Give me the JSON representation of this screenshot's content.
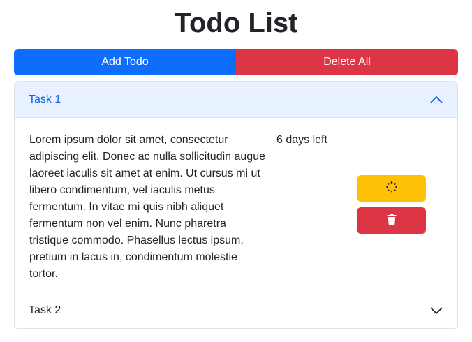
{
  "page": {
    "title": "Todo List"
  },
  "toolbar": {
    "add_label": "Add Todo",
    "delete_all_label": "Delete All"
  },
  "colors": {
    "primary": "#0d6efd",
    "danger": "#dc3545",
    "warning": "#ffc107",
    "accordion_active_bg": "#e7f1ff",
    "accordion_active_text": "#0c63e4"
  },
  "todos": [
    {
      "title": "Task 1",
      "expanded": true,
      "description": "Lorem ipsum dolor sit amet, consectetur adipiscing elit. Donec ac nulla sollicitudin augue laoreet iaculis sit amet at enim. Ut cursus mi ut libero condimentum, vel iaculis metus fermentum. In vitae mi quis nibh aliquet fermentum non vel enim. Nunc pharetra tristique commodo. Phasellus lectus ipsum, pretium in lacus in, condimentum molestie tortor.",
      "time_left": "6 days left",
      "actions": {
        "edit_icon": "spinner-icon",
        "delete_icon": "trash-icon"
      }
    },
    {
      "title": "Task 2",
      "expanded": false
    }
  ]
}
